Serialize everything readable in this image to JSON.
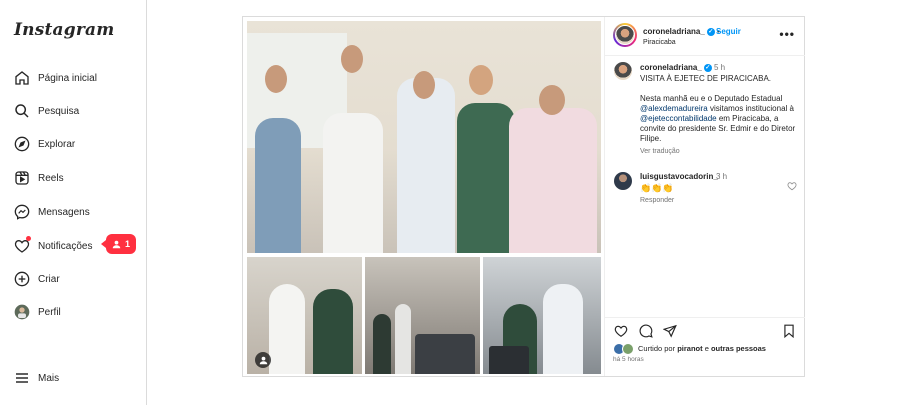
{
  "sidebar": {
    "logo": "Instagram",
    "items": [
      {
        "label": "Página inicial",
        "icon": "home-icon"
      },
      {
        "label": "Pesquisa",
        "icon": "search-icon"
      },
      {
        "label": "Explorar",
        "icon": "compass-icon"
      },
      {
        "label": "Reels",
        "icon": "reels-icon"
      },
      {
        "label": "Mensagens",
        "icon": "messenger-icon"
      },
      {
        "label": "Notificações",
        "icon": "heart-icon"
      },
      {
        "label": "Criar",
        "icon": "plus-square-icon"
      },
      {
        "label": "Perfil",
        "icon": "avatar-icon"
      },
      {
        "label": "Mais",
        "icon": "menu-icon"
      }
    ],
    "notification_badge_count": "1"
  },
  "post": {
    "username": "coroneladriana_",
    "follow_label": "Seguir",
    "separator": "•",
    "location": "Piracicaba",
    "more": "•••",
    "caption": {
      "username": "coroneladriana_",
      "time": "5 h",
      "title": "VISITA À EJETEC DE PIRACICABA.",
      "text_1": "Nesta manhã eu e o Deputado Estadual ",
      "mention_1": "@alexdemadureira",
      "text_2": " visitamos institucional à ",
      "mention_2": "@ejeteccontabilidade",
      "text_3": " em Piracicaba, a convite do presidente Sr. Edmir e do Diretor Filipe.",
      "see_translation": "Ver tradução"
    },
    "comment": {
      "username": "luisgustavocadorin_",
      "time": "3 h",
      "text": "👏👏👏",
      "reply_label": "Responder"
    },
    "likes": {
      "prefix": "Curtido por ",
      "user": "piranot",
      "suffix": " e ",
      "others": "outras pessoas"
    },
    "time_ago": "há 5 horas"
  },
  "colors": {
    "accent": "#0095f6",
    "notification": "#ff3040",
    "mention": "#00376b",
    "secondary_text": "#737373"
  }
}
